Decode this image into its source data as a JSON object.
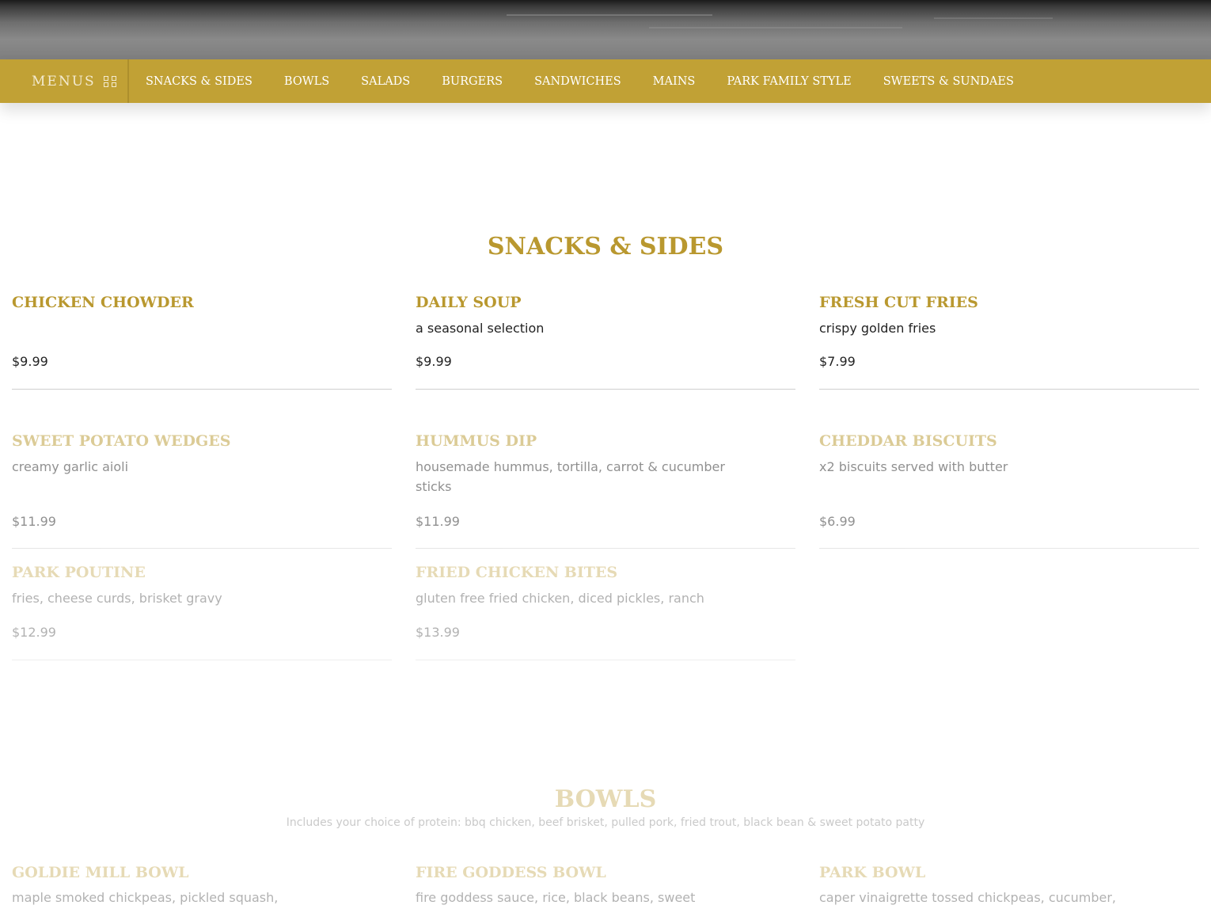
{
  "nav": {
    "menus_label": "MENUS",
    "links": [
      "SNACKS & SIDES",
      "BOWLS",
      "SALADS",
      "BURGERS",
      "SANDWICHES",
      "MAINS",
      "PARK FAMILY STYLE",
      "SWEETS & SUNDAES"
    ]
  },
  "snacks": {
    "title": "SNACKS & SIDES",
    "items": [
      {
        "name": "CHICKEN CHOWDER",
        "desc": "",
        "price": "$9.99"
      },
      {
        "name": "DAILY SOUP",
        "desc": "a seasonal selection",
        "price": "$9.99"
      },
      {
        "name": "FRESH CUT FRIES",
        "desc": "crispy golden fries",
        "price": "$7.99"
      },
      {
        "name": "SWEET POTATO WEDGES",
        "desc": "creamy garlic aioli",
        "price": "$11.99"
      },
      {
        "name": "HUMMUS DIP",
        "desc": "housemade hummus, tortilla, carrot & cucumber sticks",
        "price": "$11.99"
      },
      {
        "name": "CHEDDAR BISCUITS",
        "desc": "x2 biscuits served with butter",
        "price": "$6.99"
      },
      {
        "name": "PARK POUTINE",
        "desc": "fries, cheese curds, brisket gravy",
        "price": "$12.99"
      },
      {
        "name": "FRIED CHICKEN BITES",
        "desc": "gluten free fried chicken, diced pickles, ranch",
        "price": "$13.99"
      }
    ]
  },
  "bowls": {
    "title": "BOWLS",
    "subtitle": "Includes your choice of protein: bbq chicken, beef brisket, pulled pork, fried trout, black bean & sweet potato patty",
    "items": [
      {
        "name": "GOLDIE MILL BOWL",
        "desc": "maple smoked chickpeas, pickled squash,"
      },
      {
        "name": "FIRE GODDESS BOWL",
        "desc": "fire goddess sauce, rice, black beans, sweet"
      },
      {
        "name": "PARK BOWL",
        "desc": "caper vinaigrette tossed chickpeas, cucumber,"
      }
    ]
  }
}
